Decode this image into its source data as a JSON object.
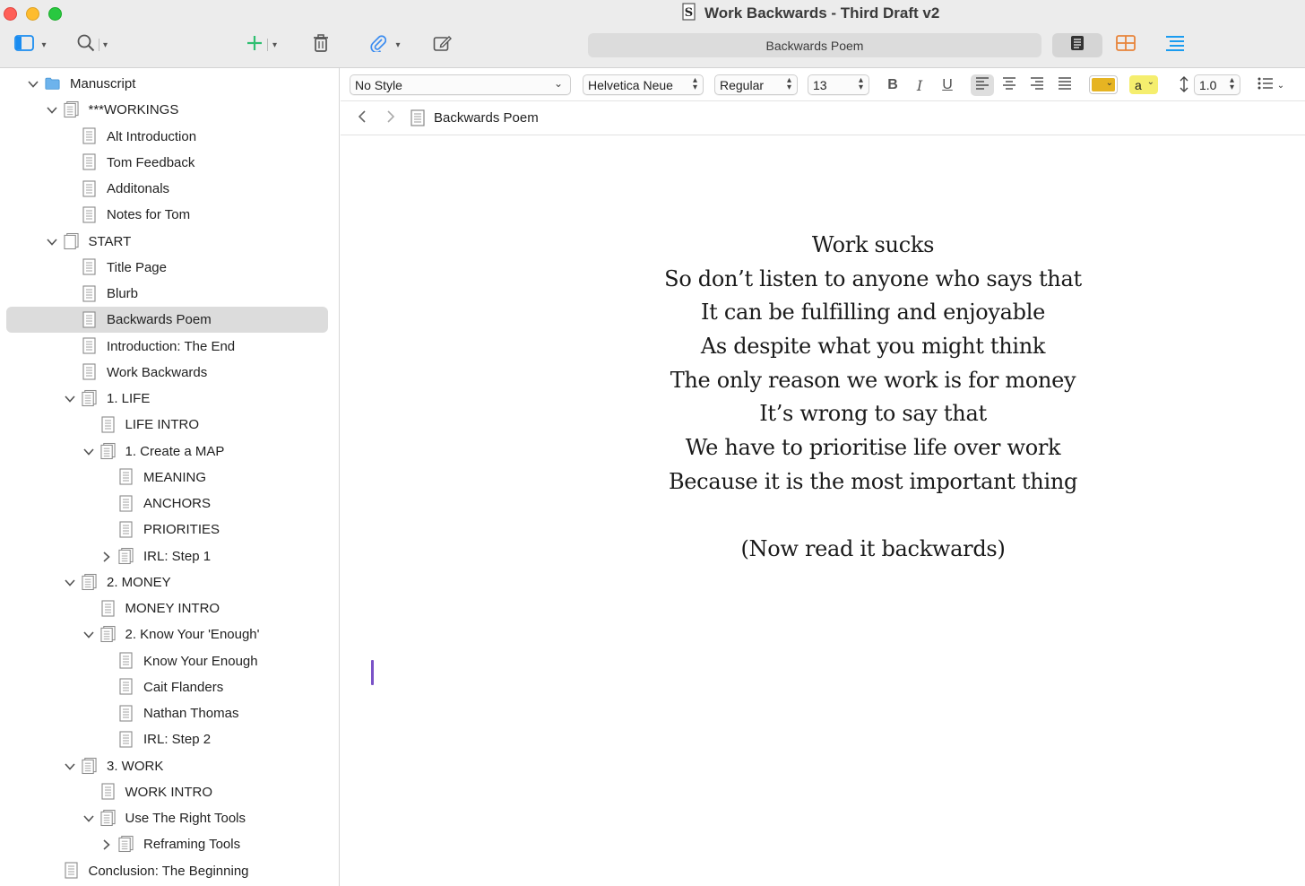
{
  "window": {
    "title": "Work Backwards - Third Draft v2",
    "header_title": "Backwards Poem"
  },
  "binder": {
    "items": [
      {
        "label": "Manuscript",
        "level": 0,
        "icon": "folder-icon",
        "disclosure": "expanded"
      },
      {
        "label": "***WORKINGS",
        "level": 1,
        "icon": "document-stack-icon",
        "disclosure": "expanded"
      },
      {
        "label": "Alt Introduction",
        "level": 2,
        "icon": "document-icon",
        "disclosure": "none"
      },
      {
        "label": "Tom Feedback",
        "level": 2,
        "icon": "document-icon",
        "disclosure": "none"
      },
      {
        "label": "Additonals",
        "level": 2,
        "icon": "document-icon",
        "disclosure": "none"
      },
      {
        "label": "Notes for Tom",
        "level": 2,
        "icon": "document-icon",
        "disclosure": "none"
      },
      {
        "label": "START",
        "level": 1,
        "icon": "blank-document-stack-icon",
        "disclosure": "expanded"
      },
      {
        "label": "Title Page",
        "level": 2,
        "icon": "document-icon",
        "disclosure": "none"
      },
      {
        "label": "Blurb",
        "level": 2,
        "icon": "document-icon",
        "disclosure": "none"
      },
      {
        "label": "Backwards Poem",
        "level": 2,
        "icon": "document-icon",
        "disclosure": "none",
        "selected": true
      },
      {
        "label": "Introduction: The End",
        "level": 2,
        "icon": "document-icon",
        "disclosure": "none"
      },
      {
        "label": "Work Backwards",
        "level": 2,
        "icon": "document-icon",
        "disclosure": "none"
      },
      {
        "label": "1. LIFE",
        "level": 2,
        "icon": "document-stack-icon",
        "disclosure": "expanded"
      },
      {
        "label": "LIFE INTRO",
        "level": 3,
        "icon": "document-icon",
        "disclosure": "none"
      },
      {
        "label": "1. Create a MAP",
        "level": 3,
        "icon": "document-stack-icon",
        "disclosure": "expanded"
      },
      {
        "label": "MEANING",
        "level": 4,
        "icon": "document-icon",
        "disclosure": "none"
      },
      {
        "label": "ANCHORS",
        "level": 4,
        "icon": "document-icon",
        "disclosure": "none"
      },
      {
        "label": "PRIORITIES",
        "level": 4,
        "icon": "document-icon",
        "disclosure": "none"
      },
      {
        "label": "IRL: Step 1",
        "level": 4,
        "icon": "document-stack-icon",
        "disclosure": "collapsed"
      },
      {
        "label": "2. MONEY",
        "level": 2,
        "icon": "document-stack-icon",
        "disclosure": "expanded"
      },
      {
        "label": "MONEY INTRO",
        "level": 3,
        "icon": "document-icon",
        "disclosure": "none"
      },
      {
        "label": "2. Know Your 'Enough'",
        "level": 3,
        "icon": "document-stack-icon",
        "disclosure": "expanded"
      },
      {
        "label": "Know Your Enough",
        "level": 4,
        "icon": "document-icon",
        "disclosure": "none"
      },
      {
        "label": "Cait Flanders",
        "level": 4,
        "icon": "document-icon",
        "disclosure": "none"
      },
      {
        "label": "Nathan Thomas",
        "level": 4,
        "icon": "document-icon",
        "disclosure": "none"
      },
      {
        "label": "IRL: Step 2",
        "level": 4,
        "icon": "document-icon",
        "disclosure": "none"
      },
      {
        "label": "3. WORK",
        "level": 2,
        "icon": "document-stack-icon",
        "disclosure": "expanded"
      },
      {
        "label": "WORK INTRO",
        "level": 3,
        "icon": "document-icon",
        "disclosure": "none"
      },
      {
        "label": "Use The Right Tools",
        "level": 3,
        "icon": "document-stack-icon",
        "disclosure": "expanded"
      },
      {
        "label": "Reframing Tools",
        "level": 4,
        "icon": "document-stack-icon",
        "disclosure": "collapsed"
      },
      {
        "label": "Conclusion: The Beginning",
        "level": 1,
        "icon": "document-icon",
        "disclosure": "none"
      }
    ]
  },
  "format_bar": {
    "style": "No Style",
    "font": "Helvetica Neue",
    "weight": "Regular",
    "size": "13",
    "text_color": "#e6b422",
    "highlight_label": "a",
    "highlight_color": "#f5ee6e",
    "line_spacing": "1.0"
  },
  "editor": {
    "doc_title": "Backwards Poem",
    "poem_lines": [
      "Work sucks",
      "So don’t listen to anyone who says that",
      "It can be fulfilling and enjoyable",
      "As despite what you might think",
      "The only reason we work is for money",
      "It’s wrong to say that",
      "We have to prioritise life over work",
      "Because it is the most important thing",
      "",
      "(Now read it backwards)"
    ],
    "caret_color": "#7a52c7"
  },
  "colors": {
    "add_green": "#2fbf71",
    "attach_blue": "#3b8cf0",
    "corkboard_orange": "#e8843a",
    "outline_blue": "#1a9cf0",
    "folder_blue": "#6db3ec"
  }
}
